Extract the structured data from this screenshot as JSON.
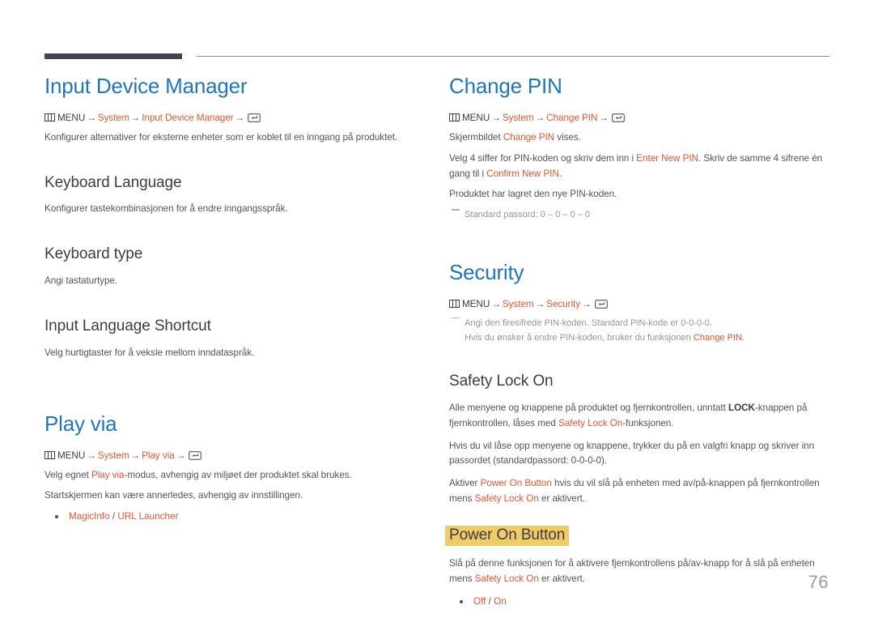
{
  "page": {
    "number": "76",
    "colors": {
      "heading_blue": "#2176b8",
      "link_orange": "#e05634",
      "highlight_yellow": "#f0cc69",
      "body_grey": "#55535c",
      "note_grey": "#97959d",
      "rule_dark": "#474554"
    }
  },
  "icons": {
    "menu": "menu-icon",
    "enter": "enter-key-icon"
  },
  "left_column": {
    "section1": {
      "title": "Input Device Manager",
      "path": {
        "menu_label": "MENU",
        "step1": "System",
        "step2": "Input Device Manager",
        "arrow": "→"
      },
      "description": "Konfigurer alternativer for eksterne enheter som er koblet til en inngang på produktet.",
      "subsections": [
        {
          "title": "Keyboard Language",
          "description": "Konfigurer tastekombinasjonen for å endre inngangsspråk."
        },
        {
          "title": "Keyboard type",
          "description": "Angi tastaturtype."
        },
        {
          "title": "Input Language Shortcut",
          "description": "Velg hurtigtaster for å veksle mellom inndataspråk."
        }
      ]
    },
    "section2": {
      "title": "Play via",
      "path": {
        "menu_label": "MENU",
        "step1": "System",
        "step2": "Play via",
        "arrow": "→"
      },
      "line1_pre": "Velg egnet ",
      "line1_link": "Play via",
      "line1_post": "-modus, avhengig av miljøet der produktet skal brukes.",
      "line2": "Startskjermen kan være annerledes, avhengig av innstillingen.",
      "bullets": [
        {
          "opt1": "MagicInfo",
          "sep": " / ",
          "opt2": "URL Launcher"
        }
      ]
    }
  },
  "right_column": {
    "section1": {
      "title": "Change PIN",
      "path": {
        "menu_label": "MENU",
        "step1": "System",
        "step2": "Change PIN",
        "arrow": "→"
      },
      "line1_pre": "Skjermbildet ",
      "line1_link": "Change PIN",
      "line1_post": " vises.",
      "line2_pre": "Velg 4 siffer for PIN-koden og skriv dem inn i ",
      "line2_link1": "Enter New PIN",
      "line2_mid": ". Skriv de samme 4 sifrene én gang til i ",
      "line2_link2": "Confirm New PIN",
      "line2_post": ".",
      "line3": "Produktet har lagret den nye PIN-koden.",
      "note": "Standard passord: 0 – 0 – 0 – 0"
    },
    "section2": {
      "title": "Security",
      "path": {
        "menu_label": "MENU",
        "step1": "System",
        "step2": "Security",
        "arrow": "→"
      },
      "note_line1": "Angi den firesifrede PIN-koden. Standard PIN-kode er 0-0-0-0.",
      "note_line2_pre": "Hvis du ønsker å endre PIN-koden, bruker du funksjonen ",
      "note_line2_link": "Change PIN",
      "note_line2_post": ".",
      "subsections": [
        {
          "title": "Safety Lock On",
          "p1_pre": "Alle menyene og knappene på produktet og fjernkontrollen, unntatt ",
          "p1_bold": "LOCK",
          "p1_mid": "-knappen på fjernkontrollen, låses med ",
          "p1_link": "Safety Lock On",
          "p1_post": "-funksjonen.",
          "p2": "Hvis du vil låse opp menyene og knappene, trykker du på en valgfri knapp og skriver inn passordet (standardpassord: 0-0-0-0).",
          "p3_pre": "Aktiver ",
          "p3_link1": "Power On Button",
          "p3_mid": " hvis du vil slå på enheten med av/på-knappen på fjernkontrollen mens ",
          "p3_link2": "Safety Lock On",
          "p3_post": " er aktivert."
        },
        {
          "title": "Power On Button",
          "highlighted": true,
          "p1_pre": "Slå på denne funksjonen for å aktivere fjernkontrollens på/av-knapp for å slå på enheten mens ",
          "p1_link": "Safety Lock On",
          "p1_post": " er aktivert.",
          "bullets": [
            {
              "opt1": "Off",
              "sep": " / ",
              "opt2": "On"
            }
          ]
        }
      ]
    }
  }
}
